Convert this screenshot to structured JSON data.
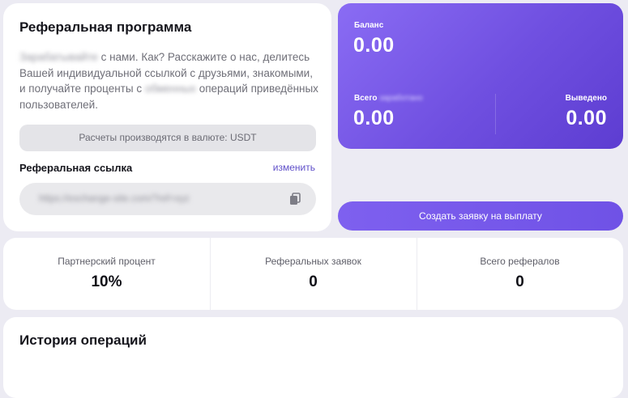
{
  "referral": {
    "title": "Реферальная программа",
    "desc_blur_1": "Зарабатывайте",
    "desc_part_1": " с нами. Как? Расскажите о нас, делитесь Вашей индивидуальной ссылкой с друзьями, знакомыми, и получайте проценты с ",
    "desc_blur_2": "обменных",
    "desc_part_2": " операций приведённых пользователей.",
    "currency_note": "Расчеты производятся в валюте: USDT",
    "link_label": "Реферальная ссылка",
    "change_label": "изменить",
    "link_value": "https://exchange-site.com/?ref=xyz"
  },
  "balance": {
    "balance_label": "Баланс",
    "balance_value": "0.00",
    "total_label": "Всего",
    "total_label_blur": "заработано",
    "total_value": "0.00",
    "withdrawn_label": "Выведено",
    "withdrawn_value": "0.00"
  },
  "payout_button": "Создать заявку на выплату",
  "stats": [
    {
      "label": "Партнерский процент",
      "value": "10%"
    },
    {
      "label": "Реферальных заявок",
      "value": "0"
    },
    {
      "label": "Всего рефералов",
      "value": "0"
    }
  ],
  "history": {
    "title": "История операций"
  },
  "colors": {
    "accent": "#6f4fe0",
    "link": "#5f4fc9",
    "background": "#ecebf3"
  },
  "icons": {
    "copy": "copy-icon"
  }
}
